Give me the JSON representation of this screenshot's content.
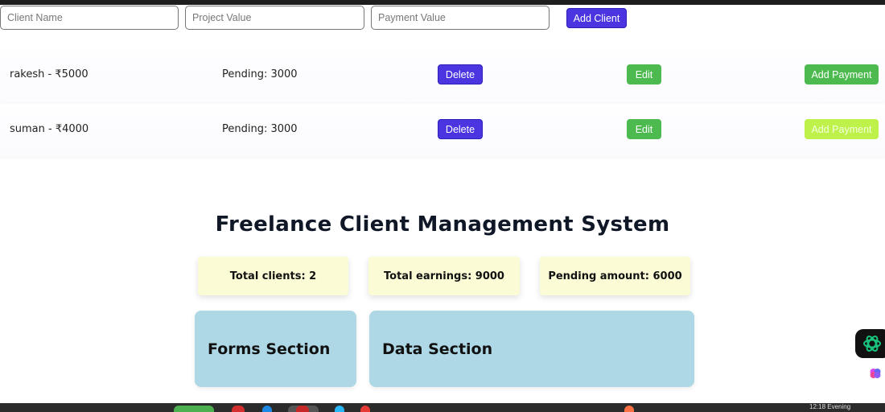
{
  "form": {
    "client_name_placeholder": "Client Name",
    "project_value_placeholder": "Project Value",
    "payment_value_placeholder": "Payment Value",
    "add_client_label": "Add Client"
  },
  "clients": [
    {
      "name_value": "rakesh - ₹5000",
      "pending": "Pending: 3000",
      "delete_label": "Delete",
      "edit_label": "Edit",
      "add_payment_label": "Add Payment"
    },
    {
      "name_value": "suman - ₹4000",
      "pending": "Pending: 3000",
      "delete_label": "Delete",
      "edit_label": "Edit",
      "add_payment_label": "Add Payment"
    }
  ],
  "page_title": "Freelance Client Management System",
  "stats": {
    "total_clients": "Total clients: 2",
    "total_earnings": "Total earnings: 9000",
    "pending_amount": "Pending amount: 6000"
  },
  "sections": {
    "forms": "Forms Section",
    "data": "Data Section"
  },
  "taskbar": {
    "clock": "12:18 Evening"
  },
  "colors": {
    "primary_button": "#4a35e0",
    "success_button": "#4cba4f",
    "highlight_button": "#bef14a",
    "stat_card": "#fbfbd6",
    "section_panel": "#aed8e5"
  },
  "icons": [
    "openai-assistant-icon",
    "brain-icon"
  ]
}
